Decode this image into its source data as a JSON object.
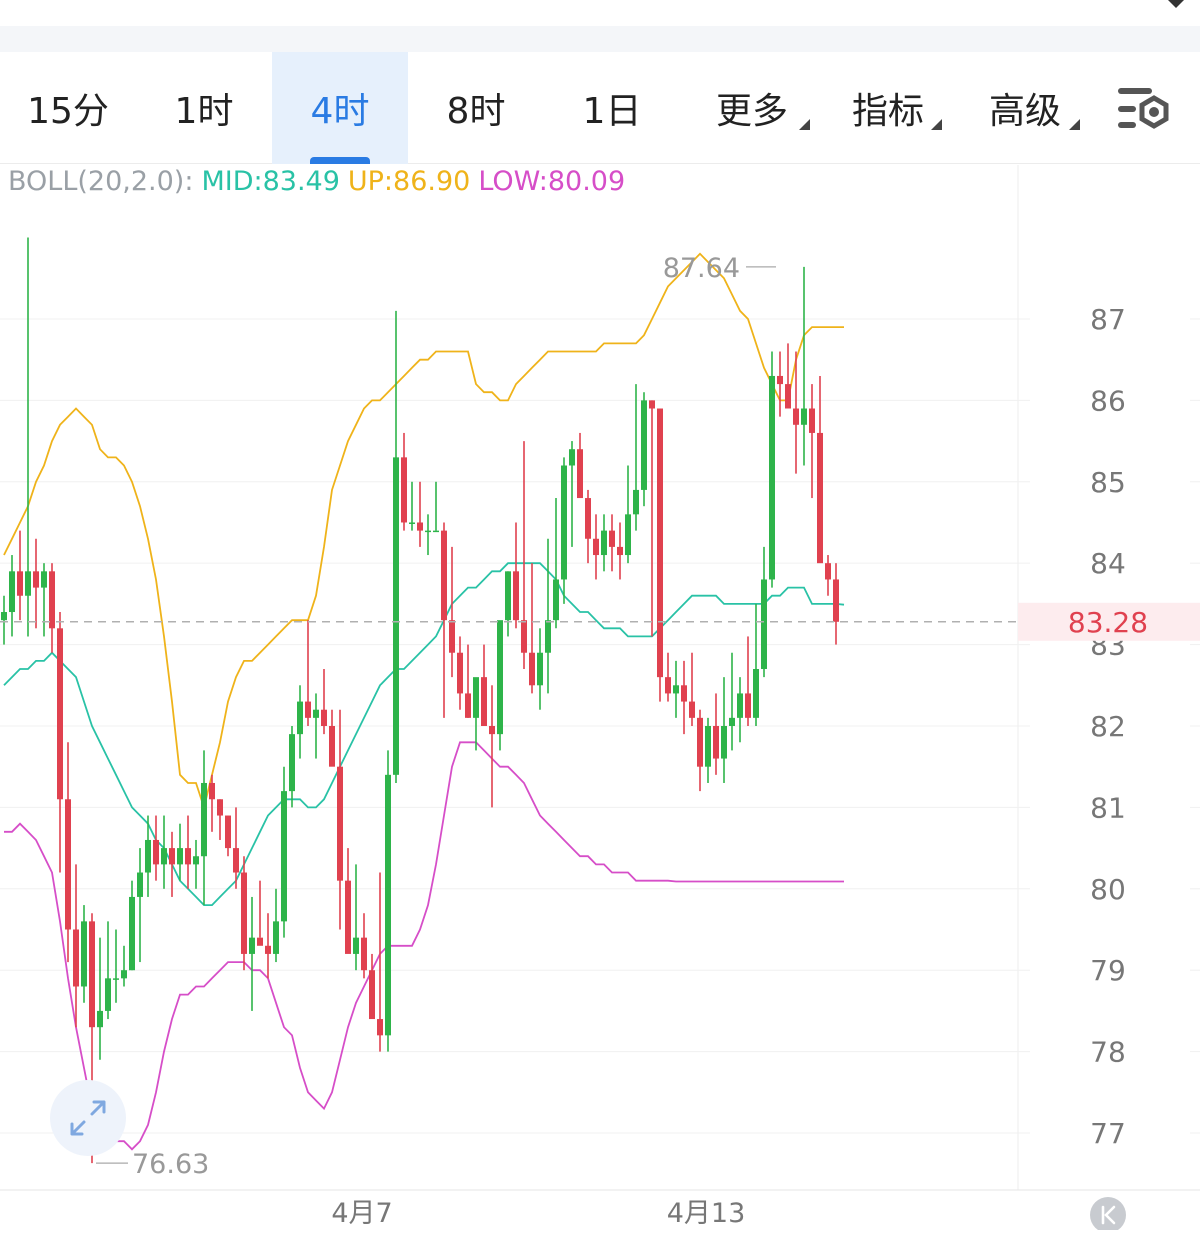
{
  "tabs": [
    {
      "label": "15分",
      "active": false,
      "dropdown": false
    },
    {
      "label": "1时",
      "active": false,
      "dropdown": false
    },
    {
      "label": "4时",
      "active": true,
      "dropdown": false
    },
    {
      "label": "8时",
      "active": false,
      "dropdown": false
    },
    {
      "label": "1日",
      "active": false,
      "dropdown": false
    },
    {
      "label": "更多",
      "active": false,
      "dropdown": true
    },
    {
      "label": "指标",
      "active": false,
      "dropdown": true
    },
    {
      "label": "高级",
      "active": false,
      "dropdown": true
    }
  ],
  "settings_icon": "chart-settings-icon",
  "indicator": {
    "name": "BOLL(20,2.0):",
    "mid": "MID:83.49",
    "up": "UP:86.90",
    "low": "LOW:80.09"
  },
  "colors": {
    "up_candle": "#2eb44a",
    "down_candle": "#e0414f",
    "mid_line": "#29c2a6",
    "upper_line": "#efb31a",
    "lower_line": "#d64ec8",
    "price_line": "#b0b0b0",
    "price_label": "#e0414f",
    "accent": "#2a7be3"
  },
  "chart_data": {
    "type": "candlestick",
    "title": "",
    "ylim": [
      76.3,
      88.4
    ],
    "y_ticks": [
      "87",
      "86",
      "85",
      "84",
      "83",
      "82",
      "81",
      "80",
      "79",
      "78",
      "77"
    ],
    "x_labels": [
      {
        "label": "4月7",
        "index": 44
      },
      {
        "label": "4月13",
        "index": 87
      }
    ],
    "last_price": "83.28",
    "high_marker": {
      "label": "87.64",
      "index": 97,
      "value": 87.64
    },
    "low_marker": {
      "label": "76.63",
      "index": 11,
      "value": 76.63
    },
    "grid": true,
    "candles_ohlc": [
      [
        83.3,
        83.6,
        83.0,
        83.4
      ],
      [
        83.4,
        84.1,
        83.1,
        83.9
      ],
      [
        83.9,
        84.4,
        83.3,
        83.6
      ],
      [
        83.6,
        88.0,
        83.1,
        83.9
      ],
      [
        83.9,
        84.3,
        83.2,
        83.7
      ],
      [
        83.7,
        84.0,
        83.1,
        83.9
      ],
      [
        83.9,
        84.0,
        82.9,
        83.2
      ],
      [
        83.2,
        83.4,
        80.2,
        81.1
      ],
      [
        81.1,
        81.8,
        79.1,
        79.5
      ],
      [
        79.5,
        80.3,
        78.3,
        78.8
      ],
      [
        78.8,
        79.8,
        78.6,
        79.6
      ],
      [
        79.6,
        79.7,
        76.63,
        78.3
      ],
      [
        78.3,
        79.4,
        77.9,
        78.5
      ],
      [
        78.5,
        79.6,
        78.4,
        78.9
      ],
      [
        78.9,
        79.5,
        78.6,
        78.9
      ],
      [
        78.9,
        79.3,
        78.8,
        79.0
      ],
      [
        79.0,
        80.1,
        79.0,
        79.9
      ],
      [
        79.9,
        80.5,
        79.1,
        80.2
      ],
      [
        80.2,
        80.9,
        79.9,
        80.6
      ],
      [
        80.6,
        80.9,
        80.1,
        80.3
      ],
      [
        80.3,
        80.9,
        80.0,
        80.5
      ],
      [
        80.5,
        80.7,
        79.9,
        80.3
      ],
      [
        80.3,
        80.8,
        80.1,
        80.5
      ],
      [
        80.5,
        80.9,
        80.0,
        80.3
      ],
      [
        80.3,
        80.6,
        80.0,
        80.4
      ],
      [
        80.4,
        81.7,
        79.8,
        81.3
      ],
      [
        81.3,
        81.4,
        80.7,
        81.1
      ],
      [
        81.1,
        81.1,
        80.6,
        80.9
      ],
      [
        80.9,
        80.9,
        80.4,
        80.5
      ],
      [
        80.5,
        81.0,
        80.0,
        80.2
      ],
      [
        80.2,
        80.4,
        79.0,
        79.2
      ],
      [
        79.2,
        79.9,
        78.5,
        79.4
      ],
      [
        79.4,
        80.1,
        79.4,
        79.3
      ],
      [
        79.3,
        79.7,
        78.9,
        79.2
      ],
      [
        79.2,
        80.0,
        79.1,
        79.6
      ],
      [
        79.6,
        81.5,
        79.4,
        81.2
      ],
      [
        81.2,
        82.0,
        81.0,
        81.9
      ],
      [
        81.9,
        82.5,
        81.6,
        82.3
      ],
      [
        82.3,
        83.3,
        82.0,
        82.1
      ],
      [
        82.1,
        82.4,
        81.6,
        82.2
      ],
      [
        82.2,
        82.7,
        81.9,
        82.0
      ],
      [
        82.0,
        82.2,
        81.8,
        81.5
      ],
      [
        81.5,
        82.2,
        79.5,
        80.1
      ],
      [
        80.1,
        80.5,
        79.9,
        79.2
      ],
      [
        79.2,
        80.3,
        79.0,
        79.4
      ],
      [
        79.4,
        79.7,
        78.9,
        79.0
      ],
      [
        79.0,
        79.2,
        78.6,
        78.4
      ],
      [
        78.4,
        80.2,
        78.0,
        78.2
      ],
      [
        78.2,
        81.7,
        78.0,
        81.4
      ],
      [
        81.4,
        87.1,
        81.3,
        85.3
      ],
      [
        85.3,
        85.6,
        84.4,
        84.5
      ],
      [
        84.5,
        85.0,
        84.4,
        84.5
      ],
      [
        84.5,
        85.0,
        84.2,
        84.4
      ],
      [
        84.4,
        84.6,
        84.1,
        84.4
      ],
      [
        84.4,
        85.0,
        84.4,
        84.4
      ],
      [
        84.4,
        84.5,
        82.1,
        83.3
      ],
      [
        83.3,
        84.2,
        82.6,
        82.9
      ],
      [
        82.9,
        83.1,
        82.2,
        82.4
      ],
      [
        82.4,
        83.0,
        82.1,
        82.1
      ],
      [
        82.1,
        82.3,
        81.7,
        82.6
      ],
      [
        82.6,
        83.0,
        82.2,
        82.0
      ],
      [
        82.0,
        82.5,
        81.0,
        81.9
      ],
      [
        81.9,
        83.0,
        81.7,
        83.3
      ],
      [
        83.3,
        83.9,
        83.1,
        83.9
      ],
      [
        83.9,
        84.5,
        83.2,
        83.3
      ],
      [
        83.3,
        85.5,
        82.7,
        82.9
      ],
      [
        82.9,
        84.0,
        82.4,
        82.5
      ],
      [
        82.5,
        83.2,
        82.2,
        82.9
      ],
      [
        82.9,
        84.3,
        82.4,
        83.3
      ],
      [
        83.3,
        84.8,
        83.2,
        83.8
      ],
      [
        83.8,
        85.3,
        83.5,
        85.2
      ],
      [
        85.2,
        85.5,
        84.2,
        85.4
      ],
      [
        85.4,
        85.6,
        84.9,
        84.8
      ],
      [
        84.8,
        84.9,
        84.0,
        84.3
      ],
      [
        84.3,
        84.6,
        83.8,
        84.1
      ],
      [
        84.1,
        84.6,
        83.9,
        84.4
      ],
      [
        84.4,
        84.6,
        83.9,
        84.2
      ],
      [
        84.2,
        84.5,
        83.8,
        84.1
      ],
      [
        84.1,
        85.2,
        84.0,
        84.6
      ],
      [
        84.6,
        86.2,
        84.4,
        84.9
      ],
      [
        84.9,
        86.1,
        84.7,
        86.0
      ],
      [
        86.0,
        86.0,
        83.1,
        85.9
      ],
      [
        85.9,
        85.9,
        82.3,
        82.6
      ],
      [
        82.6,
        82.9,
        82.3,
        82.4
      ],
      [
        82.4,
        82.8,
        82.1,
        82.5
      ],
      [
        82.5,
        82.8,
        81.9,
        82.3
      ],
      [
        82.3,
        82.9,
        82.0,
        82.1
      ],
      [
        82.1,
        82.2,
        81.2,
        81.5
      ],
      [
        81.5,
        82.1,
        81.3,
        82.0
      ],
      [
        82.0,
        82.4,
        81.4,
        81.6
      ],
      [
        81.6,
        82.6,
        81.3,
        82.0
      ],
      [
        82.0,
        82.9,
        81.7,
        82.1
      ],
      [
        82.1,
        82.6,
        81.8,
        82.4
      ],
      [
        82.4,
        83.1,
        82.0,
        82.1
      ],
      [
        82.1,
        83.5,
        82.0,
        82.7
      ],
      [
        82.7,
        84.2,
        82.6,
        83.8
      ],
      [
        83.8,
        86.6,
        83.7,
        86.3
      ],
      [
        86.3,
        86.6,
        85.8,
        86.2
      ],
      [
        86.2,
        86.7,
        85.9,
        85.9
      ],
      [
        85.9,
        86.6,
        85.1,
        85.7
      ],
      [
        85.7,
        87.64,
        85.2,
        85.9
      ],
      [
        85.9,
        86.2,
        84.8,
        85.6
      ],
      [
        85.6,
        86.3,
        84.3,
        84.0
      ],
      [
        84.0,
        84.1,
        83.6,
        83.8
      ],
      [
        83.8,
        84.0,
        83.0,
        83.28
      ]
    ],
    "bollinger": {
      "upper": [
        84.1,
        84.3,
        84.5,
        84.7,
        85.0,
        85.2,
        85.5,
        85.7,
        85.8,
        85.9,
        85.8,
        85.7,
        85.4,
        85.3,
        85.3,
        85.2,
        85.0,
        84.7,
        84.3,
        83.8,
        83.1,
        82.3,
        81.4,
        81.3,
        81.3,
        81.0,
        81.4,
        81.8,
        82.3,
        82.6,
        82.8,
        82.8,
        82.9,
        83.0,
        83.1,
        83.2,
        83.3,
        83.3,
        83.3,
        83.6,
        84.2,
        84.9,
        85.2,
        85.5,
        85.7,
        85.9,
        86.0,
        86.0,
        86.1,
        86.2,
        86.3,
        86.4,
        86.5,
        86.5,
        86.6,
        86.6,
        86.6,
        86.6,
        86.6,
        86.2,
        86.1,
        86.1,
        86.0,
        86.0,
        86.2,
        86.3,
        86.4,
        86.5,
        86.6,
        86.6,
        86.6,
        86.6,
        86.6,
        86.6,
        86.6,
        86.7,
        86.7,
        86.7,
        86.7,
        86.7,
        86.8,
        87.0,
        87.2,
        87.4,
        87.5,
        87.6,
        87.7,
        87.8,
        87.7,
        87.6,
        87.5,
        87.3,
        87.1,
        87.0,
        86.7,
        86.4,
        86.2,
        86.0,
        86.0,
        86.5,
        86.8,
        86.9,
        86.9,
        86.9,
        86.9,
        86.9
      ],
      "middle": [
        82.5,
        82.6,
        82.7,
        82.7,
        82.8,
        82.8,
        82.9,
        82.8,
        82.7,
        82.6,
        82.3,
        82.0,
        81.8,
        81.6,
        81.4,
        81.2,
        81.0,
        80.9,
        80.8,
        80.6,
        80.5,
        80.3,
        80.1,
        80.0,
        79.9,
        79.8,
        79.8,
        79.9,
        80.0,
        80.1,
        80.3,
        80.5,
        80.7,
        80.9,
        81.0,
        81.1,
        81.1,
        81.1,
        81.0,
        81.0,
        81.1,
        81.3,
        81.5,
        81.7,
        81.9,
        82.1,
        82.3,
        82.5,
        82.6,
        82.7,
        82.7,
        82.8,
        82.9,
        83.0,
        83.1,
        83.3,
        83.5,
        83.6,
        83.7,
        83.7,
        83.8,
        83.9,
        83.9,
        84.0,
        84.0,
        84.0,
        84.0,
        84.0,
        83.9,
        83.8,
        83.6,
        83.5,
        83.4,
        83.4,
        83.3,
        83.2,
        83.2,
        83.2,
        83.1,
        83.1,
        83.1,
        83.1,
        83.2,
        83.3,
        83.4,
        83.5,
        83.6,
        83.6,
        83.6,
        83.6,
        83.5,
        83.5,
        83.5,
        83.5,
        83.5,
        83.5,
        83.6,
        83.6,
        83.7,
        83.7,
        83.7,
        83.5,
        83.5,
        83.5,
        83.5,
        83.49
      ],
      "lower": [
        80.7,
        80.7,
        80.8,
        80.7,
        80.6,
        80.4,
        80.2,
        79.6,
        78.9,
        78.3,
        77.8,
        77.3,
        77.1,
        77.0,
        76.9,
        76.9,
        76.8,
        76.9,
        77.1,
        77.5,
        78.0,
        78.4,
        78.7,
        78.7,
        78.8,
        78.8,
        78.9,
        79.0,
        79.1,
        79.1,
        79.1,
        79.0,
        79.0,
        78.9,
        78.6,
        78.3,
        78.2,
        77.8,
        77.5,
        77.4,
        77.3,
        77.5,
        77.9,
        78.3,
        78.6,
        78.8,
        79.0,
        79.2,
        79.3,
        79.3,
        79.3,
        79.3,
        79.5,
        79.8,
        80.3,
        80.9,
        81.5,
        81.8,
        81.8,
        81.8,
        81.7,
        81.6,
        81.5,
        81.5,
        81.4,
        81.3,
        81.1,
        80.9,
        80.8,
        80.7,
        80.6,
        80.5,
        80.4,
        80.4,
        80.3,
        80.3,
        80.2,
        80.2,
        80.2,
        80.1,
        80.1,
        80.1,
        80.1,
        80.1,
        80.09,
        80.09,
        80.09,
        80.09,
        80.09,
        80.09,
        80.09,
        80.09,
        80.09,
        80.09,
        80.09,
        80.09,
        80.09,
        80.09,
        80.09,
        80.09,
        80.09,
        80.09,
        80.09,
        80.09,
        80.09,
        80.09
      ]
    }
  }
}
